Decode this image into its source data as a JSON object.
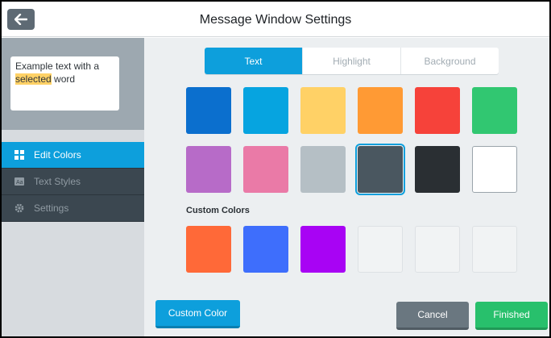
{
  "window": {
    "title": "Message Window Settings"
  },
  "preview": {
    "text_before": "Example text with a",
    "highlighted": "selected",
    "text_after": " word"
  },
  "nav": {
    "items": [
      {
        "label": "Edit Colors",
        "icon": "grid-icon"
      },
      {
        "label": "Text Styles",
        "icon": "text-icon"
      },
      {
        "label": "Settings",
        "icon": "gear-icon"
      }
    ],
    "active": "Edit Colors"
  },
  "tabs": [
    {
      "label": "Text"
    },
    {
      "label": "Highlight"
    },
    {
      "label": "Background"
    }
  ],
  "active_tab": "Text",
  "palette": [
    "#0b6fce",
    "#06a4e0",
    "#ffd166",
    "#ff9a34",
    "#f6423a",
    "#31c771",
    "#b76bc8",
    "#ea7aa7",
    "#b5bfc5",
    "#4a5760",
    "#2a2f33",
    "#ffffff"
  ],
  "selected_color": "#4a5760",
  "custom_colors": {
    "label": "Custom Colors",
    "colors": [
      "#ff6938",
      "#3e6efc",
      "#a803f4",
      "",
      "",
      ""
    ]
  },
  "buttons": {
    "custom_color": "Custom Color",
    "cancel": "Cancel",
    "finished": "Finished"
  },
  "colors": {
    "accent": "#0d9fdc",
    "success": "#28c06c",
    "sidebar_dark": "#3b4750"
  }
}
